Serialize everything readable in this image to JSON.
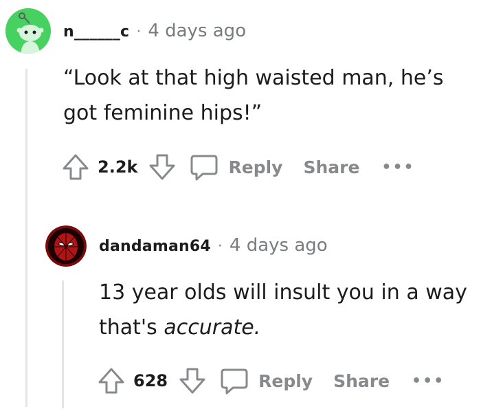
{
  "comments": [
    {
      "username": "n______c",
      "separator": "·",
      "time": "4 days ago",
      "body_line1": "“Look at that high waisted man, he’s",
      "body_line2": "got feminine hips!”",
      "score": "2.2k",
      "reply_label": "Reply",
      "share_label": "Share",
      "more_label": "•••",
      "avatar_color": "#46d160"
    },
    {
      "username": "dandaman64",
      "separator": "·",
      "time": "4 days ago",
      "body_line1": "13 year olds will insult you in a way",
      "body_line2_prefix": "that's ",
      "body_line2_em": "accurate.",
      "score": "628",
      "reply_label": "Reply",
      "share_label": "Share",
      "more_label": "•••",
      "avatar_color": "#8b0000"
    }
  ],
  "icons": [
    "snoo-avatar-icon",
    "spiderman-avatar-icon",
    "upvote-icon",
    "downvote-icon",
    "comment-icon"
  ],
  "colors": {
    "text": "#1c1c1c",
    "muted": "#878a8c",
    "thread": "#e5e5e5"
  }
}
